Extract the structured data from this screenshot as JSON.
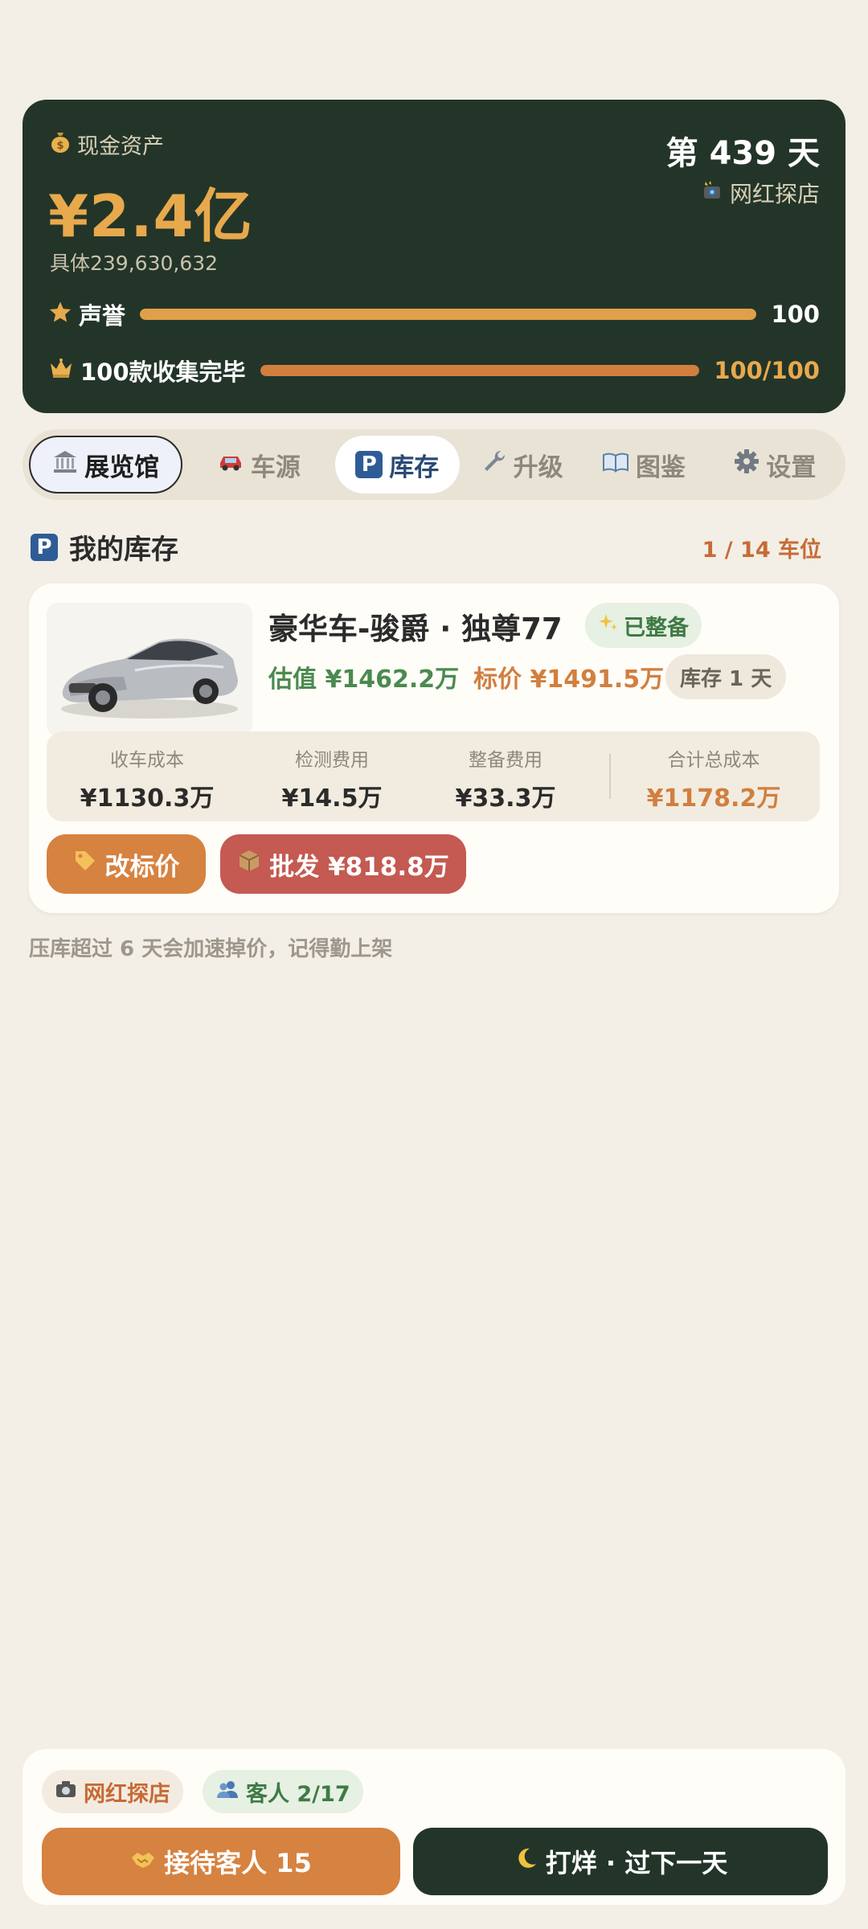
{
  "header": {
    "cash_label": "现金资产",
    "cash_big": "¥2.4亿",
    "cash_exact": "具体239,630,632",
    "day": "第 439 天",
    "event": "网红探店",
    "reputation": {
      "label": "声誉",
      "value": "100",
      "level": 1.0
    },
    "collection": {
      "label": "100款收集完毕",
      "value": "100/100",
      "level": 1.0
    }
  },
  "tabs": [
    {
      "label": "展览馆",
      "icon": "museum-icon"
    },
    {
      "label": "车源",
      "icon": "car-icon"
    },
    {
      "label": "库存",
      "icon": "parking-icon"
    },
    {
      "label": "升级",
      "icon": "wrench-icon"
    },
    {
      "label": "图鉴",
      "icon": "book-icon"
    },
    {
      "label": "设置",
      "icon": "gear-icon"
    }
  ],
  "inventory": {
    "title": "我的库存",
    "slots": "1 / 14 车位",
    "car": {
      "name": "豪华车-骏爵 · 独尊77",
      "ready_badge": "已整备",
      "estimate": "估值 ¥1462.2万",
      "tag_price": "标价 ¥1491.5万",
      "stock_days": "库存 1 天",
      "costs": [
        {
          "label": "收车成本",
          "value": "¥1130.3万"
        },
        {
          "label": "检测费用",
          "value": "¥14.5万"
        },
        {
          "label": "整备费用",
          "value": "¥33.3万"
        },
        {
          "label": "合计总成本",
          "value": "¥1178.2万"
        }
      ],
      "reprice_button": "改标价",
      "wholesale_button": "批发 ¥818.8万"
    },
    "hint": "压库超过 6 天会加速掉价，记得勤上架"
  },
  "bottom": {
    "event_chip": "网红探店",
    "guests_chip": "客人 2/17",
    "serve_button": "接待客人 15",
    "close_button": "打烊 · 过下一天"
  },
  "colors": {
    "dark_green": "#233529",
    "accent_orange": "#d68240",
    "gold": "#e8a94c",
    "wholesale_red": "#c45a52",
    "estimate_green": "#4b8a4f",
    "background": "#f3efe6"
  }
}
